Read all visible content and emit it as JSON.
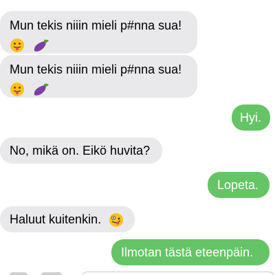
{
  "conversation": {
    "messages": [
      {
        "direction": "incoming",
        "text": "Mun tekis niiin mieli p#nna sua!",
        "emoji": [
          "tongue-out-emoji",
          "eggplant-emoji"
        ]
      },
      {
        "direction": "incoming",
        "text": "Mun tekis niiin mieli p#nna sua!",
        "emoji": [
          "tongue-out-emoji",
          "eggplant-emoji"
        ]
      },
      {
        "direction": "outgoing",
        "text": "Hyi."
      },
      {
        "direction": "incoming",
        "text": "No, mikä on. Eikö huvita?"
      },
      {
        "direction": "outgoing",
        "text": "Lopeta."
      },
      {
        "direction": "incoming",
        "text": "Haluut kuitenkin.",
        "emoji": [
          "zany-face-emoji"
        ]
      },
      {
        "direction": "outgoing",
        "text": "Ilmotan tästä eteenpäin."
      }
    ]
  },
  "colors": {
    "incoming_bubble": "#e9e9eb",
    "outgoing_bubble": "#65c466",
    "outgoing_text": "#ffffff"
  }
}
